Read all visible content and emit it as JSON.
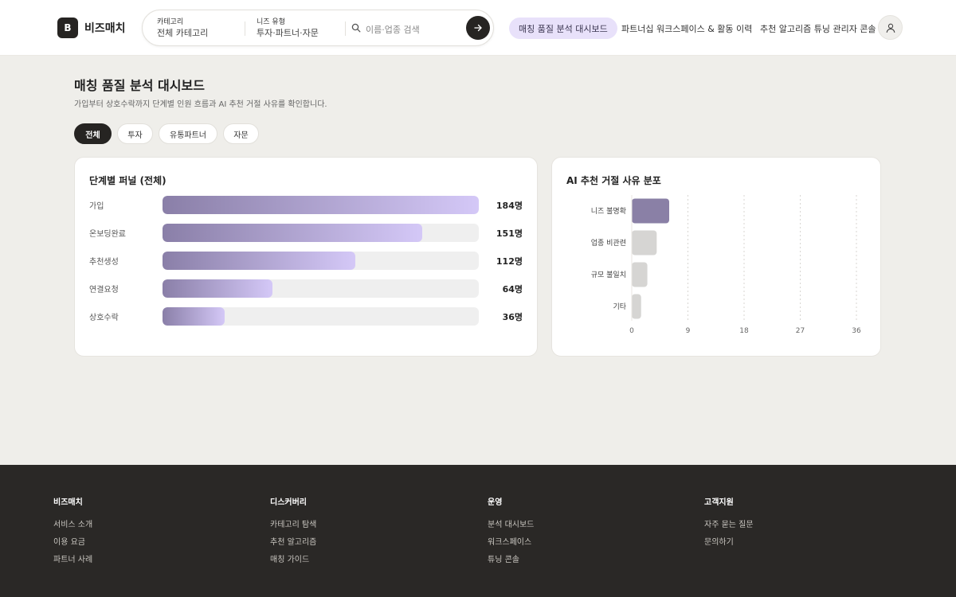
{
  "header": {
    "logo_letter": "B",
    "brand": "비즈매치",
    "search": {
      "category_label": "카테고리",
      "category_value": "전체 카테고리",
      "needs_label": "니즈 유형",
      "needs_value": "투자·파트너·자문",
      "placeholder": "이름·업종 검색"
    },
    "nav": [
      "매칭 품질 분석 대시보드",
      "파트너십 워크스페이스 & 활동 이력",
      "추천 알고리즘 튜닝 관리자 콘솔"
    ]
  },
  "page": {
    "title": "매칭 품질 분석 대시보드",
    "subtitle": "가입부터 상호수락까지 단계별 인원 흐름과 AI 추천 거절 사유를 확인합니다.",
    "filters": [
      "전체",
      "투자",
      "유통파트너",
      "자문"
    ],
    "active_filter": "전체"
  },
  "funnel": {
    "title": "단계별 퍼널 (전체)",
    "max": 184,
    "rows": [
      {
        "label": "가입",
        "value": 184,
        "display": "184명"
      },
      {
        "label": "온보딩완료",
        "value": 151,
        "display": "151명"
      },
      {
        "label": "추천생성",
        "value": 112,
        "display": "112명"
      },
      {
        "label": "연결요청",
        "value": 64,
        "display": "64명"
      },
      {
        "label": "상호수락",
        "value": 36,
        "display": "36명"
      }
    ]
  },
  "chart_data": {
    "type": "bar",
    "orientation": "horizontal",
    "title": "AI 추천 거절 사유 분포",
    "categories": [
      "니즈 불명확",
      "업종 비관련",
      "규모 불일치",
      "기타"
    ],
    "values": [
      6,
      4,
      2.5,
      1.5
    ],
    "xlim": [
      0,
      36
    ],
    "xticks": [
      "0",
      "9",
      "18",
      "27",
      "36"
    ],
    "grid": true,
    "colors": {
      "highlight": "#8a80a6",
      "default": "#d6d5d3"
    }
  },
  "footer": {
    "columns": [
      {
        "title": "비즈매치",
        "links": [
          "서비스 소개",
          "이용 요금",
          "파트너 사례"
        ]
      },
      {
        "title": "디스커버리",
        "links": [
          "카테고리 탐색",
          "추천 알고리즘",
          "매칭 가이드"
        ]
      },
      {
        "title": "운영",
        "links": [
          "분석 대시보드",
          "워크스페이스",
          "튜닝 콘솔"
        ]
      },
      {
        "title": "고객지원",
        "links": [
          "자주 묻는 질문",
          "문의하기"
        ]
      }
    ]
  }
}
